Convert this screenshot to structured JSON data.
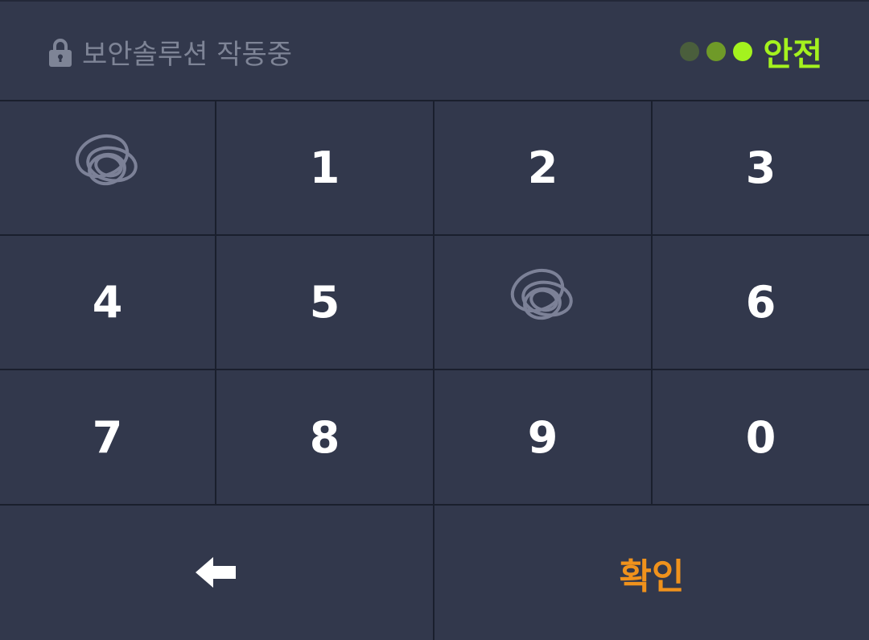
{
  "header": {
    "security_label": "보안솔루션 작동중",
    "safety_label": "안전",
    "indicator_dots": [
      "#4a5e3c",
      "#6f9a28",
      "#a4f21e"
    ],
    "safety_color": "#a4f21e"
  },
  "keypad": {
    "keys": [
      {
        "label": "",
        "type": "blank",
        "icon": "swirl-icon"
      },
      {
        "label": "1",
        "type": "digit"
      },
      {
        "label": "2",
        "type": "digit"
      },
      {
        "label": "3",
        "type": "digit"
      },
      {
        "label": "4",
        "type": "digit"
      },
      {
        "label": "5",
        "type": "digit"
      },
      {
        "label": "",
        "type": "blank",
        "icon": "swirl-icon"
      },
      {
        "label": "6",
        "type": "digit"
      },
      {
        "label": "7",
        "type": "digit"
      },
      {
        "label": "8",
        "type": "digit"
      },
      {
        "label": "9",
        "type": "digit"
      },
      {
        "label": "0",
        "type": "digit"
      }
    ],
    "backspace_icon": "left-arrow-icon",
    "confirm_label": "확인",
    "confirm_color": "#f0921c"
  }
}
